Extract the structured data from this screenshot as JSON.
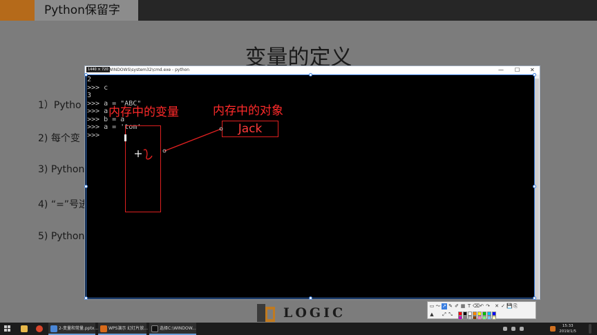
{
  "slide": {
    "tab_title": "Python保留字",
    "title": "变量的定义",
    "bullets": [
      "1）Pytho",
      "2) 每个变",
      "3) Python",
      "4) “=”号进",
      "5) Python"
    ],
    "logo_text": "LOGIC"
  },
  "cmd": {
    "size_badge": "1440 × 720",
    "title": "WINDOWS\\system32\\cmd.exe - python",
    "minimize": "—",
    "maximize": "☐",
    "close": "✕",
    "lines": [
      "2",
      ">>> c",
      "3",
      ">>> a = \"ABC\"",
      ">>> a",
      ">>> b = a",
      ">>> a = 'tom'",
      ">>> "
    ]
  },
  "annotations": {
    "variable_label": "内存中的变量",
    "object_label": "内存中的对象",
    "object_value": "Jack",
    "color": "#ff2a2a"
  },
  "toolbar": {
    "tools": [
      "▭",
      "〜",
      "➚",
      "✎",
      "✐",
      "▦",
      "T",
      "⌫",
      "↶",
      "↷",
      "✕",
      "✓",
      "💾",
      "⎘",
      "▲",
      "⤢",
      "⤡"
    ],
    "swatches": [
      "#ff0000",
      "#000000",
      "#ffffff",
      "#ff8800",
      "#ffff00",
      "#00c000",
      "#00c0ff",
      "#0000ff",
      "#c000c0",
      "#808080",
      "#c0c0c0",
      "#804000",
      "#ff80c0",
      "#80ff80",
      "#80c0ff",
      "#ffffc0"
    ]
  },
  "taskbar": {
    "tasks": [
      "2-变量和常量.pptx...",
      "WPS演示 幻灯片放...",
      "选择C:\\WINDOW..."
    ],
    "time": "15:33",
    "date": "2019/1/5"
  }
}
